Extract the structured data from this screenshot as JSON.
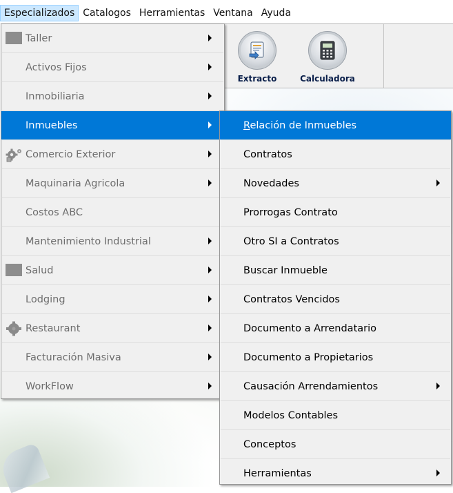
{
  "menubar": {
    "items": [
      {
        "label": "Especializados",
        "active": true
      },
      {
        "label": "Catalogos",
        "active": false
      },
      {
        "label": "Herramientas",
        "active": false
      },
      {
        "label": "Ventana",
        "active": false
      },
      {
        "label": "Ayuda",
        "active": false
      }
    ]
  },
  "toolbar": {
    "extracto_label": "Extracto",
    "calculadora_label": "Calculadora"
  },
  "menu": {
    "items": [
      {
        "label": "Taller",
        "icon": "gray-square-icon",
        "submenu": true
      },
      {
        "label": "Activos Fijos",
        "icon": "",
        "submenu": true
      },
      {
        "label": "Inmobiliaria",
        "icon": "",
        "submenu": true
      },
      {
        "label": "Inmuebles",
        "icon": "",
        "submenu": true,
        "selected": true
      },
      {
        "label": "Comercio Exterior",
        "icon": "gears-icon",
        "submenu": true
      },
      {
        "label": "Maquinaria Agricola",
        "icon": "",
        "submenu": true
      },
      {
        "label": "Costos ABC",
        "icon": "",
        "submenu": false
      },
      {
        "label": "Mantenimiento Industrial",
        "icon": "",
        "submenu": true
      },
      {
        "label": "Salud",
        "icon": "gray-square-icon",
        "submenu": true
      },
      {
        "label": "Lodging",
        "icon": "",
        "submenu": true
      },
      {
        "label": "Restaurant",
        "icon": "gear-icon",
        "submenu": true
      },
      {
        "label": "Facturación Masiva",
        "icon": "",
        "submenu": true
      },
      {
        "label": "WorkFlow",
        "icon": "",
        "submenu": true
      }
    ]
  },
  "submenu": {
    "first_item": {
      "mnemonic": "R",
      "rest": "elación de Inmuebles"
    },
    "items": [
      {
        "label": "Contratos",
        "submenu": false
      },
      {
        "label": "Novedades",
        "submenu": true
      },
      {
        "label": "Prorrogas Contrato",
        "submenu": false
      },
      {
        "label": "Otro SI a Contratos",
        "submenu": false
      },
      {
        "label": "Buscar Inmueble",
        "submenu": false
      },
      {
        "label": "Contratos Vencidos",
        "submenu": false
      },
      {
        "label": "Documento a Arrendatario",
        "submenu": false
      },
      {
        "label": "Documento a Propietarios",
        "submenu": false
      },
      {
        "label": "Causación Arrendamientos",
        "submenu": true
      },
      {
        "label": "Modelos Contables",
        "submenu": false
      },
      {
        "label": "Conceptos",
        "submenu": false
      },
      {
        "label": "Herramientas",
        "submenu": true
      }
    ]
  },
  "colors": {
    "highlight": "#0078d7",
    "menubar_active": "#cce8ff",
    "disabled_text": "#6d6d6d"
  }
}
